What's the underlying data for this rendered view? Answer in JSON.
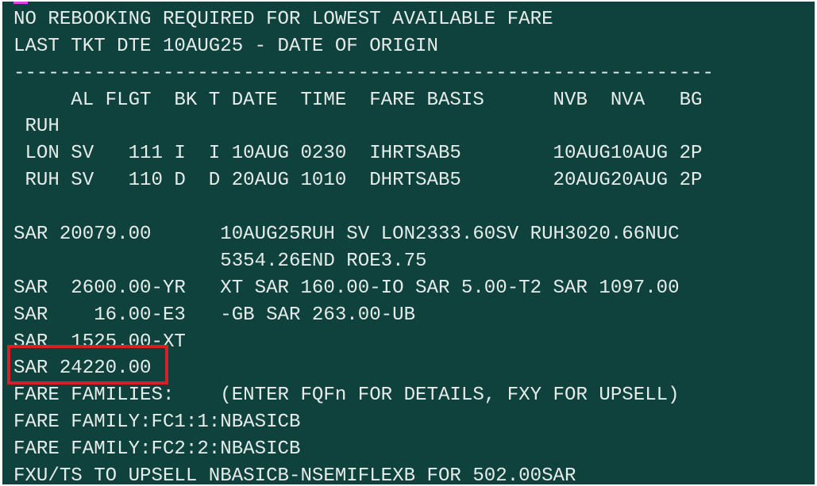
{
  "terminal": {
    "cursor_color": "#e040e8",
    "background_color": "#0f413d",
    "text_color": "#e6ecea",
    "highlight_color": "#d71f26",
    "lines": [
      "NO REBOOKING REQUIRED FOR LOWEST AVAILABLE FARE",
      "LAST TKT DTE 10AUG25 - DATE OF ORIGIN",
      "-------------------------------------------------------------",
      "     AL FLGT  BK T DATE  TIME  FARE BASIS      NVB  NVA   BG",
      " RUH",
      " LON SV   111 I  I 10AUG 0230  IHRTSAB5        10AUG10AUG 2P",
      " RUH SV   110 D  D 20AUG 1010  DHRTSAB5        20AUG20AUG 2P",
      "",
      "SAR 20079.00      10AUG25RUH SV LON2333.60SV RUH3020.66NUC",
      "                  5354.26END ROE3.75",
      "SAR  2600.00-YR   XT SAR 160.00-IO SAR 5.00-T2 SAR 1097.00",
      "SAR    16.00-E3   -GB SAR 263.00-UB",
      "SAR  1525.00-XT",
      "SAR 24220.00",
      "FARE FAMILIES:    (ENTER FQFn FOR DETAILS, FXY FOR UPSELL)",
      "FARE FAMILY:FC1:1:NBASICB",
      "FARE FAMILY:FC2:2:NBASICB",
      "FXU/TS TO UPSELL NBASICB-NSEMIFLEXB FOR 502.00SAR"
    ]
  }
}
